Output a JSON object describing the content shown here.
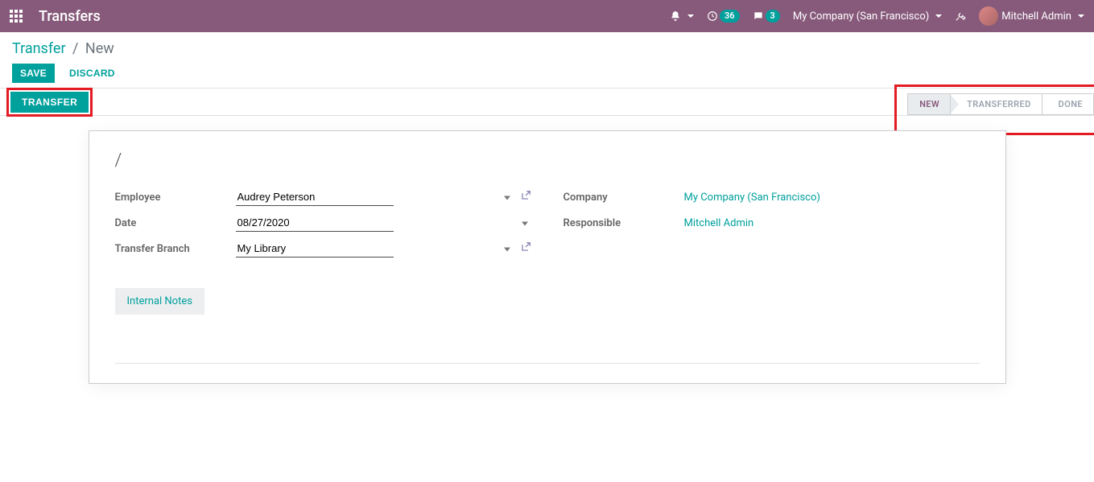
{
  "header": {
    "app_title": "Transfers",
    "clock_badge": "36",
    "chat_badge": "3",
    "company": "My Company (San Francisco)",
    "user": "Mitchell Admin"
  },
  "breadcrumb": {
    "root": "Transfer",
    "sep": "/",
    "current": "New"
  },
  "buttons": {
    "save": "Save",
    "discard": "Discard",
    "transfer": "Transfer"
  },
  "status": {
    "new": "New",
    "transferred": "Transferred",
    "done": "Done"
  },
  "record": {
    "title": "/"
  },
  "form": {
    "employee_label": "Employee",
    "employee_value": "Audrey Peterson",
    "date_label": "Date",
    "date_value": "08/27/2020",
    "branch_label": "Transfer Branch",
    "branch_value": "My Library",
    "company_label": "Company",
    "company_value": "My Company (San Francisco)",
    "responsible_label": "Responsible",
    "responsible_value": "Mitchell Admin"
  },
  "tabs": {
    "internal_notes": "Internal Notes"
  }
}
